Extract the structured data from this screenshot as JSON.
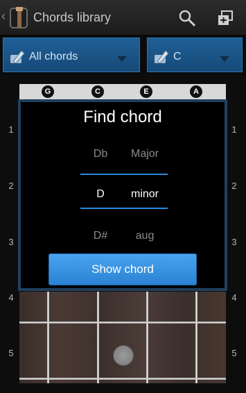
{
  "actionbar": {
    "title": "Chords library"
  },
  "filters": {
    "category": "All chords",
    "root": "C"
  },
  "fretboard": {
    "strings": [
      "G",
      "C",
      "E",
      "A"
    ],
    "fret_numbers": [
      "1",
      "2",
      "3",
      "4",
      "5"
    ]
  },
  "dialog": {
    "title": "Find chord",
    "note_options": [
      "Db",
      "D",
      "D#"
    ],
    "quality_options": [
      "Major",
      "minor",
      "aug"
    ],
    "selected_note": "D",
    "selected_quality": "minor",
    "button": "Show chord"
  },
  "colors": {
    "accent": "#2a8be0",
    "spinner": "#1f5f96"
  }
}
